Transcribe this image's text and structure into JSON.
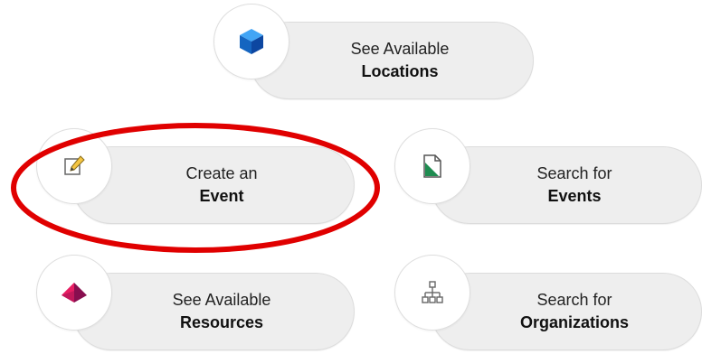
{
  "tiles": {
    "locations": {
      "line1": "See Available",
      "line2": "Locations",
      "icon": "cube-icon"
    },
    "create_event": {
      "line1": "Create an",
      "line2": "Event",
      "icon": "edit-pencil-icon"
    },
    "search_events": {
      "line1": "Search for",
      "line2": "Events",
      "icon": "document-icon"
    },
    "resources": {
      "line1": "See Available",
      "line2": "Resources",
      "icon": "pyramid-icon"
    },
    "search_organizations": {
      "line1": "Search for",
      "line2": "Organizations",
      "icon": "org-chart-icon"
    }
  },
  "colors": {
    "highlight": "#e00000",
    "cube": "#1565c0",
    "document": "#1e8c50",
    "pyramid": "#c2185b"
  }
}
